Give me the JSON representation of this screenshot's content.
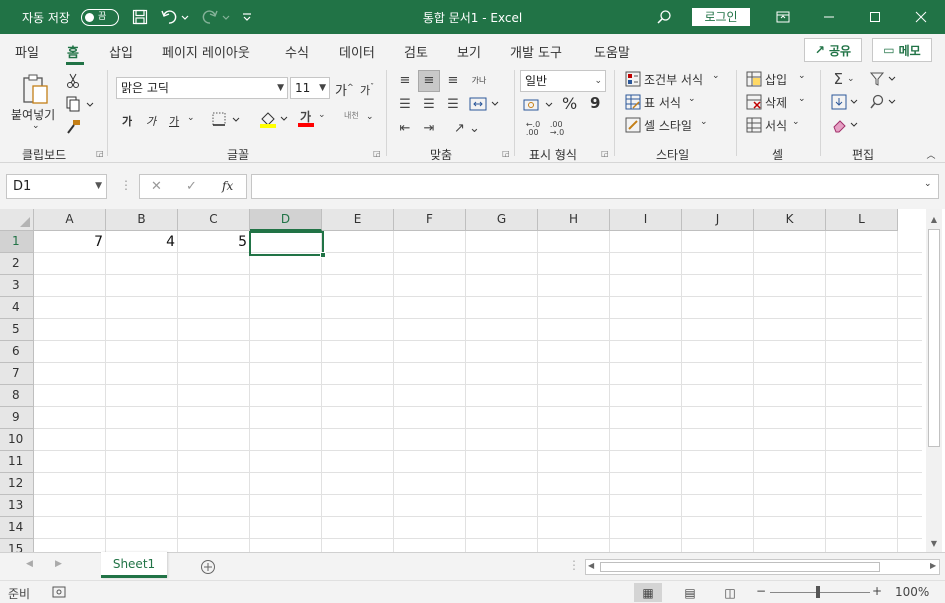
{
  "titlebar": {
    "autosave_label": "자동 저장",
    "autosave_state": "끔",
    "title": "통합 문서1  -  Excel",
    "login": "로그인",
    "icons": [
      "save-icon",
      "undo-icon",
      "redo-icon",
      "customize-qat-icon",
      "search-icon",
      "ribbon-display-icon",
      "minimize-icon",
      "maximize-icon",
      "close-icon"
    ]
  },
  "ribbon_tabs": [
    "파일",
    "홈",
    "삽입",
    "페이지 레이아웃",
    "수식",
    "데이터",
    "검토",
    "보기",
    "개발 도구",
    "도움말"
  ],
  "active_tab": "홈",
  "share_label": "공유",
  "memo_label": "메모",
  "clipboard": {
    "paste_label": "붙여넣기",
    "group_label": "클립보드"
  },
  "font": {
    "name": "맑은 고딕",
    "size": "11",
    "grow": "가",
    "shrink": "가",
    "bold": "가",
    "italic": "가",
    "underline": "가",
    "color_char": "가",
    "group_label": "글꼴",
    "phonetic": "내천"
  },
  "alignment": {
    "group_label": "맞춤",
    "wrap": "가나"
  },
  "number": {
    "format": "일반",
    "percent": "%",
    "comma": "9",
    "inc_decimal": ".0 .00",
    "dec_decimal": ".00 .0",
    "group_label": "표시 형식"
  },
  "styles": {
    "conditional": "조건부 서식",
    "table": "표 서식",
    "cell_style": "셀 스타일",
    "group_label": "스타일"
  },
  "cells": {
    "insert": "삽입",
    "delete": "삭제",
    "format": "서식",
    "group_label": "셀"
  },
  "editing": {
    "group_label": "편집",
    "sort_label": "정렬"
  },
  "formula_bar": {
    "name_box": "D1",
    "formula": "",
    "fx": "fx",
    "cancel": "✕",
    "enter": "✓"
  },
  "columns": [
    "A",
    "B",
    "C",
    "D",
    "E",
    "F",
    "G",
    "H",
    "I",
    "J",
    "K",
    "L"
  ],
  "rows": [
    "1",
    "2",
    "3",
    "4",
    "5",
    "6",
    "7",
    "8",
    "9",
    "10",
    "11",
    "12",
    "13",
    "14",
    "15"
  ],
  "selected_cell": "D1",
  "cells_data": {
    "A1": "7",
    "B1": "4",
    "C1": "5"
  },
  "sheet_tab": "Sheet1",
  "status": {
    "ready": "준비",
    "zoom": "100%"
  },
  "colors": {
    "accent": "#217346",
    "font_highlight": "#ffff00",
    "font_color": "#ff0000"
  }
}
